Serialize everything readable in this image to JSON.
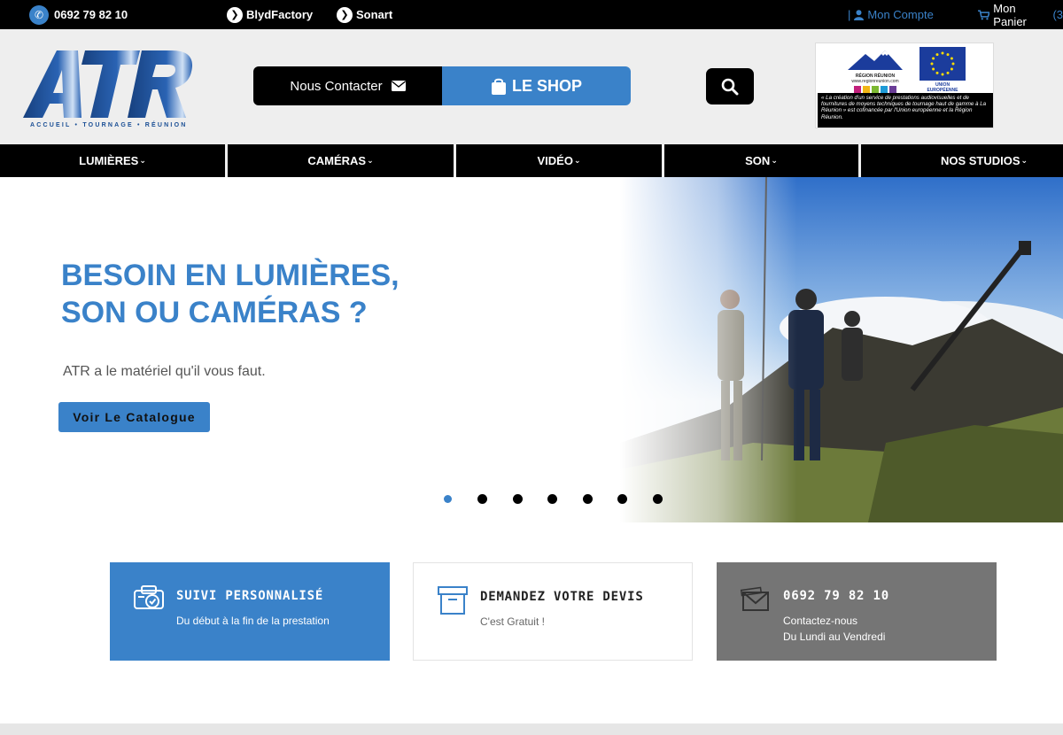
{
  "topbar": {
    "phone": "0692 79 82 10",
    "link1": "BlydFactory",
    "link2": "Sonart",
    "account": "Mon Compte",
    "cart": "Mon Panier",
    "cart_count": "(3"
  },
  "header": {
    "logo_text": "ATR",
    "logo_tagline": "ACCUEIL • TOURNAGE • RÉUNION",
    "contact_label": "Nous Contacter",
    "shop_label": "LE SHOP",
    "eu_region_label": "RÉGION RÉUNION",
    "eu_region_url": "www.regionreunion.com",
    "eu_union_label": "UNION EUROPÉENNE",
    "eu_text": "« La création d'un service de prestations audiovisuelles et de fournitures de moyens techniques de tournage haut de gamme à La Réunion » est cofinancée par l'Union européenne et la Région Réunion."
  },
  "nav": {
    "items": [
      {
        "label": "LUMIÈRES"
      },
      {
        "label": "CAMÉRAS"
      },
      {
        "label": "VIDÉO"
      },
      {
        "label": "SON"
      },
      {
        "label": "NOS STUDIOS"
      }
    ]
  },
  "hero": {
    "title_line1": "BESOIN EN LUMIÈRES,",
    "title_line2": "SON OU CAMÉRAS ?",
    "subtitle": "ATR a le matériel qu'il vous faut.",
    "cta": "Voir Le Catalogue",
    "slide_count": 7,
    "active_slide": 1
  },
  "cards": [
    {
      "title": "SUIVI PERSONNALISÉ",
      "desc1": "Du début à la fin de la prestation",
      "desc2": "",
      "icon": "support-icon"
    },
    {
      "title": "DEMANDEZ VOTRE DEVIS",
      "desc1": "C'est Gratuit !",
      "desc2": "",
      "icon": "archive-box-icon"
    },
    {
      "title": "0692 79 82 10",
      "desc1": "Contactez-nous",
      "desc2": "Du Lundi au Vendredi",
      "icon": "envelope-icon"
    }
  ],
  "colors": {
    "accent": "#3a82c9",
    "dark": "#000000",
    "grey_card": "#757575",
    "header_bg": "#eeeeee"
  }
}
